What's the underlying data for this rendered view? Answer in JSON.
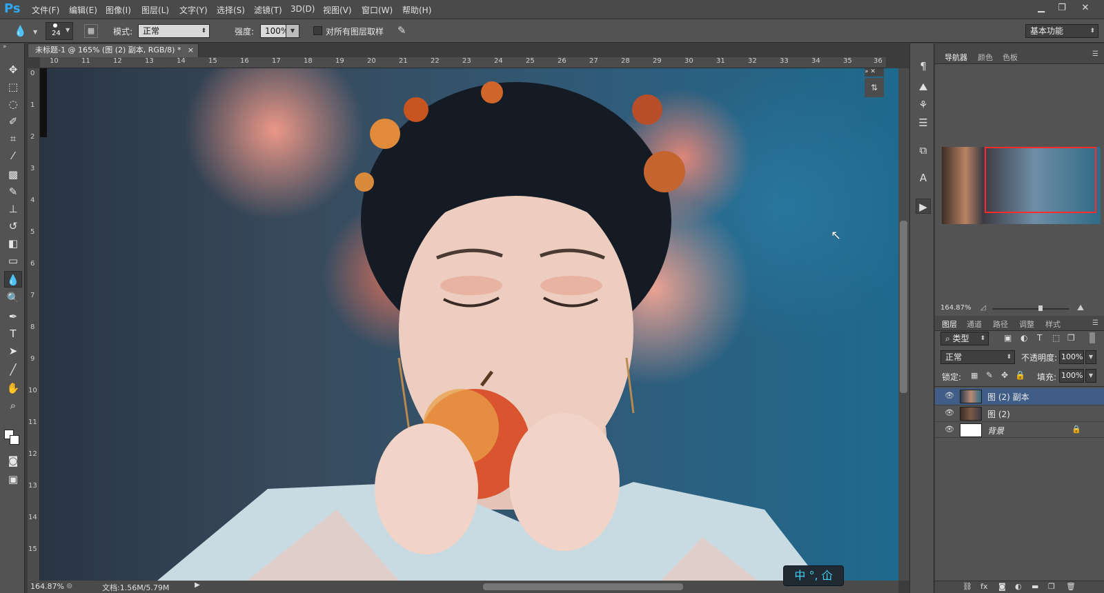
{
  "app": {
    "logo": "Ps",
    "workspace": "基本功能"
  },
  "menus": [
    "文件(F)",
    "编辑(E)",
    "图像(I)",
    "图层(L)",
    "文字(Y)",
    "选择(S)",
    "滤镜(T)",
    "3D(D)",
    "视图(V)",
    "窗口(W)",
    "帮助(H)"
  ],
  "window_controls": [
    "minimize-icon",
    "restore-icon",
    "close-icon"
  ],
  "options": {
    "brush_size": "24",
    "mode_label": "模式:",
    "mode_value": "正常",
    "strength_label": "强度:",
    "strength_value": "100%",
    "sample_all_label": "对所有图层取样"
  },
  "document": {
    "tab_title": "未标题-1 @ 165% (图 (2) 副本, RGB/8) *",
    "ruler_h": [
      "10",
      "11",
      "12",
      "13",
      "14",
      "15",
      "16",
      "17",
      "18",
      "19",
      "20",
      "21",
      "22",
      "23",
      "24",
      "25",
      "26",
      "27",
      "28",
      "29",
      "30",
      "31",
      "32",
      "33",
      "34",
      "35",
      "36"
    ],
    "ruler_v": [
      "0",
      "1",
      "2",
      "3",
      "4",
      "5",
      "6",
      "7",
      "8",
      "9",
      "10",
      "11",
      "12",
      "13",
      "14",
      "15"
    ],
    "status_zoom": "164.87%",
    "status_doc": "文档:1.56M/5.79M"
  },
  "navigator": {
    "tabs": [
      "导航器",
      "颜色",
      "色板"
    ],
    "zoom": "164.87%"
  },
  "layers_panel": {
    "tabs": [
      "图层",
      "通道",
      "路径",
      "调整",
      "样式"
    ],
    "filter_label": "类型",
    "blend_mode": "正常",
    "opacity_label": "不透明度:",
    "opacity_value": "100%",
    "lock_label": "锁定:",
    "fill_label": "填充:",
    "fill_value": "100%",
    "layers": [
      {
        "name": "图 (2) 副本",
        "selected": true
      },
      {
        "name": "图 (2)",
        "selected": false
      },
      {
        "name": "背景",
        "selected": false,
        "locked": true
      }
    ]
  },
  "ime": "中 °, 仚",
  "colors": {
    "accent": "#2fa8f5",
    "navigator_frame": "#ff2a2a",
    "selected_layer": "#3f5d87"
  }
}
